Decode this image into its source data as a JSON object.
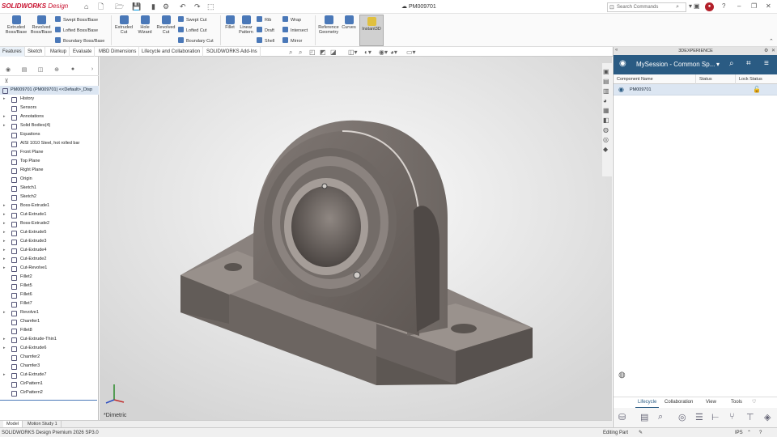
{
  "app": {
    "logo_brand": "SOLIDWORKS",
    "logo_tail": " Design",
    "document_title": "PM009701"
  },
  "title_icons": {
    "home": "home-icon",
    "new": "new-file-icon",
    "open": "open-icon",
    "save": "save-icon",
    "print": "print-icon",
    "options": "gear-icon",
    "undo": "undo-icon",
    "redo": "redo-icon",
    "select": "select-icon"
  },
  "search": {
    "placeholder": "Search Commands"
  },
  "window_controls": {
    "minimize": "–",
    "maximize": "□",
    "close": "✕",
    "restore": "❐"
  },
  "ribbon": {
    "extruded_boss": "Extruded Boss/Base",
    "revolved_boss": "Revolved Boss/Base",
    "swept_boss": "Swept Boss/Base",
    "lofted_boss": "Lofted Boss/Base",
    "boundary_boss": "Boundary Boss/Base",
    "extruded_cut": "Extruded Cut",
    "hole_wizard": "Hole Wizard",
    "revolved_cut": "Revolved Cut",
    "swept_cut": "Swept Cut",
    "lofted_cut": "Lofted Cut",
    "boundary_cut": "Boundary Cut",
    "fillet": "Fillet",
    "linear_pattern": "Linear Pattern",
    "rib": "Rib",
    "draft": "Draft",
    "shell": "Shell",
    "wrap": "Wrap",
    "intersect": "Intersect",
    "mirror": "Mirror",
    "reference_geometry": "Reference Geometry",
    "curves": "Curves",
    "instant3d": "Instant3D"
  },
  "cmd_tabs": [
    "Features",
    "Sketch",
    "Markup",
    "Evaluate",
    "MBD Dimensions",
    "Lifecycle and Collaboration",
    "SOLIDWORKS Add-Ins"
  ],
  "tree": [
    {
      "label": "PM009701 (PM009701) <<Default>_Disp",
      "exp": ""
    },
    {
      "label": "History",
      "exp": "▸"
    },
    {
      "label": "Sensors",
      "exp": ""
    },
    {
      "label": "Annotations",
      "exp": "▸"
    },
    {
      "label": "Solid Bodies(4)",
      "exp": "▸"
    },
    {
      "label": "Equations",
      "exp": ""
    },
    {
      "label": "AISI 1010 Steel, hot rolled bar",
      "exp": ""
    },
    {
      "label": "Front Plane",
      "exp": ""
    },
    {
      "label": "Top Plane",
      "exp": ""
    },
    {
      "label": "Right Plane",
      "exp": ""
    },
    {
      "label": "Origin",
      "exp": ""
    },
    {
      "label": "Sketch1",
      "exp": ""
    },
    {
      "label": "Sketch2",
      "exp": ""
    },
    {
      "label": "Boss-Extrude1",
      "exp": "▸"
    },
    {
      "label": "Cut-Extrude1",
      "exp": "▸"
    },
    {
      "label": "Boss-Extrude2",
      "exp": "▸"
    },
    {
      "label": "Cut-Extrude5",
      "exp": "▸"
    },
    {
      "label": "Cut-Extrude3",
      "exp": "▸"
    },
    {
      "label": "Cut-Extrude4",
      "exp": "▸"
    },
    {
      "label": "Cut-Extrude2",
      "exp": "▸"
    },
    {
      "label": "Cut-Revolve1",
      "exp": "▸"
    },
    {
      "label": "Fillet2",
      "exp": ""
    },
    {
      "label": "Fillet5",
      "exp": ""
    },
    {
      "label": "Fillet6",
      "exp": ""
    },
    {
      "label": "Fillet7",
      "exp": ""
    },
    {
      "label": "Revolve1",
      "exp": "▸"
    },
    {
      "label": "Chamfer1",
      "exp": ""
    },
    {
      "label": "Fillet8",
      "exp": ""
    },
    {
      "label": "Cut-Extrude-Thin1",
      "exp": "▸"
    },
    {
      "label": "Cut-Extrude6",
      "exp": "▸"
    },
    {
      "label": "Chamfer2",
      "exp": ""
    },
    {
      "label": "Chamfer3",
      "exp": ""
    },
    {
      "label": "Cut-Extrude7",
      "exp": "▸"
    },
    {
      "label": "CirPattern1",
      "exp": ""
    },
    {
      "label": "CirPattern2",
      "exp": ""
    }
  ],
  "viewport": {
    "view_name": "*Dimetric"
  },
  "bottom_tabs": [
    "Model",
    "Motion Study 1"
  ],
  "right_panel": {
    "header": "3DEXPERIENCE",
    "session": "MySession - Common Sp...",
    "columns": [
      "Component Name",
      "Status",
      "Lock Status"
    ],
    "rows": [
      {
        "name": "PM009701"
      }
    ],
    "tabs": [
      "Lifecycle",
      "Collaboration",
      "View",
      "Tools"
    ]
  },
  "status": {
    "left": "SOLIDWORKS Design Premium 2026 SP3.0",
    "mode": "Editing Part",
    "units": "IPS"
  }
}
